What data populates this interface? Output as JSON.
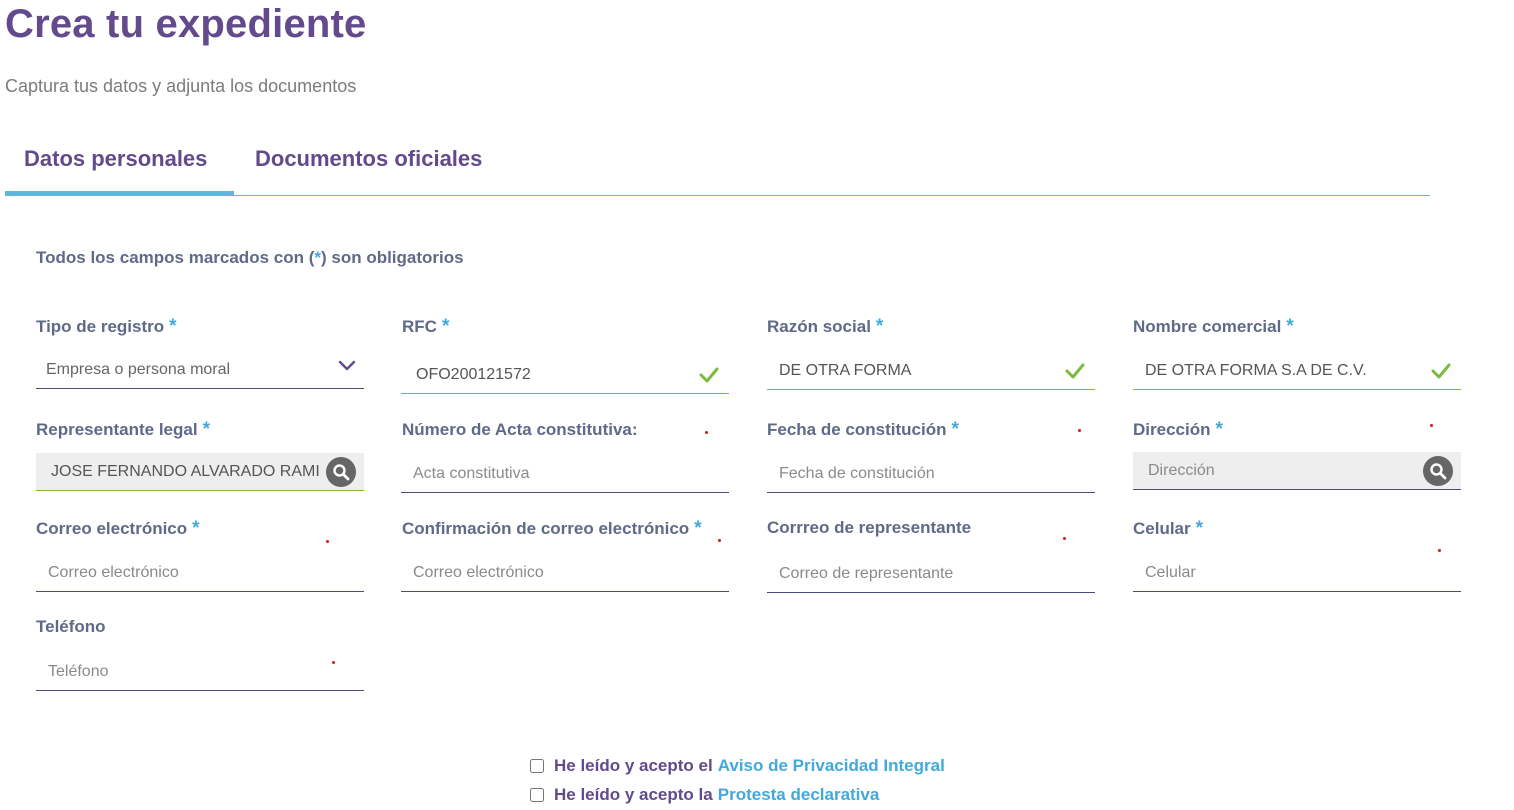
{
  "header": {
    "title": "Crea tu expediente",
    "subtitle": "Captura tus datos y adjunta los documentos"
  },
  "tabs": [
    {
      "label": "Datos personales",
      "active": true
    },
    {
      "label": "Documentos oficiales",
      "active": false
    }
  ],
  "form": {
    "required_note": {
      "before": "Todos los campos marcados con (",
      "star": "*",
      "after": ") son obligatorios"
    },
    "required_marker": "*",
    "fields": {
      "tipo_registro": {
        "label": "Tipo de registro",
        "value": "Empresa o persona moral",
        "options": [
          "Empresa o persona moral"
        ]
      },
      "rfc": {
        "label": "RFC",
        "value": "OFO200121572"
      },
      "razon_social": {
        "label": "Razón social",
        "value": "DE OTRA FORMA"
      },
      "nombre_comercial": {
        "label": "Nombre comercial",
        "value": "DE OTRA FORMA S.A DE C.V."
      },
      "representante_legal": {
        "label": "Representante legal",
        "value": "JOSE FERNANDO ALVARADO RAMIREZ"
      },
      "acta_constitutiva": {
        "label": "Número de Acta constitutiva:",
        "placeholder": "Acta constitutiva"
      },
      "fecha_constitucion": {
        "label": "Fecha de constitución",
        "placeholder": "Fecha de constitución"
      },
      "direccion": {
        "label": "Dirección",
        "placeholder": "Dirección"
      },
      "correo": {
        "label": "Correo electrónico",
        "placeholder": "Correo electrónico"
      },
      "confirmacion_correo": {
        "label": "Confirmación de correo electrónico",
        "placeholder": "Correo electrónico"
      },
      "correo_representante": {
        "label": "Corrreo de representante",
        "placeholder": "Correo de representante"
      },
      "celular": {
        "label": "Celular",
        "placeholder": "Celular"
      },
      "telefono": {
        "label": "Teléfono",
        "placeholder": "Teléfono"
      }
    }
  },
  "consents": {
    "privacy": {
      "text": "He leído y acepto el",
      "link": "Aviso de Privacidad Integral"
    },
    "protest": {
      "text": "He leído y acepto la",
      "link": "Protesta declarativa"
    }
  },
  "colors": {
    "brand_purple": "#634a8c",
    "accent_blue": "#42a9da",
    "label_gray": "#5e6a88",
    "valid_green": "#7dbb3f",
    "error_red": "#cc1f1f"
  }
}
